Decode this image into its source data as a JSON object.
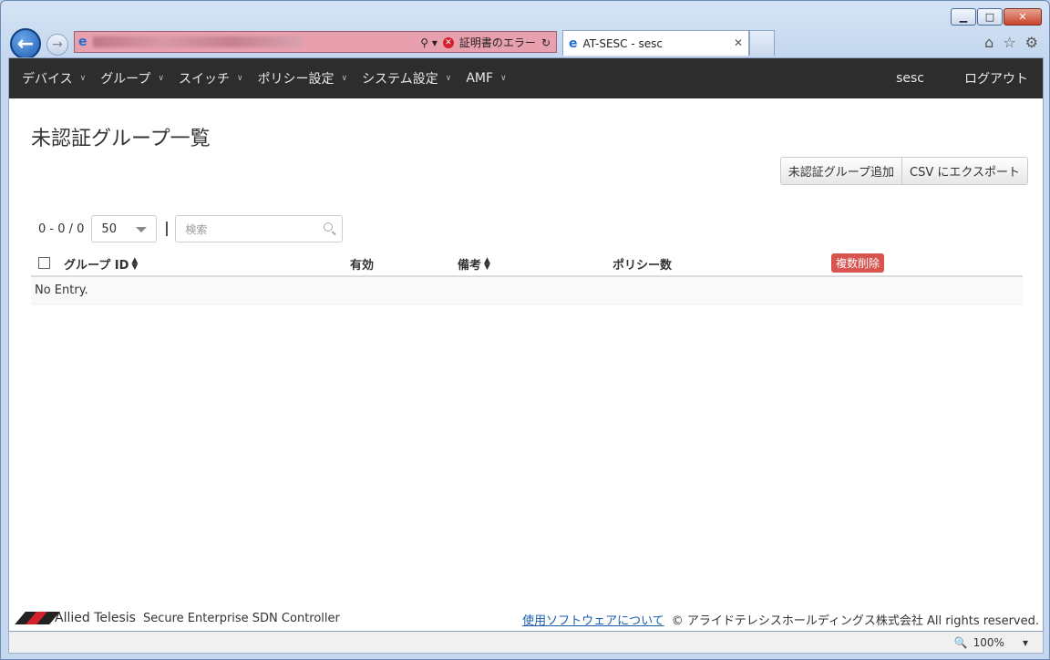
{
  "browser": {
    "address_status": "証明書のエラー",
    "tab_title": "AT-SESC - sesc",
    "zoom": "100%"
  },
  "nav": {
    "items": [
      {
        "label": "デバイス"
      },
      {
        "label": "グループ"
      },
      {
        "label": "スイッチ"
      },
      {
        "label": "ポリシー設定"
      },
      {
        "label": "システム設定"
      },
      {
        "label": "AMF"
      }
    ],
    "user": "sesc",
    "logout": "ログアウト"
  },
  "page": {
    "title": "未認証グループ一覧",
    "add_button": "未認証グループ追加",
    "export_button": "CSV にエクスポート",
    "range": "0 - 0 / 0",
    "page_size": "50",
    "search_placeholder": "検索"
  },
  "table": {
    "columns": {
      "group_id": "グループ ID",
      "enabled": "有効",
      "note": "備考",
      "policy_count": "ポリシー数",
      "bulk_delete": "複数削除"
    },
    "empty_text": "No Entry."
  },
  "footer": {
    "brand": "Allied Telesis",
    "product": "Secure Enterprise SDN Controller",
    "software_link": "使用ソフトウェアについて",
    "copyright": "© アライドテレシスホールディングス株式会社 All rights reserved."
  }
}
